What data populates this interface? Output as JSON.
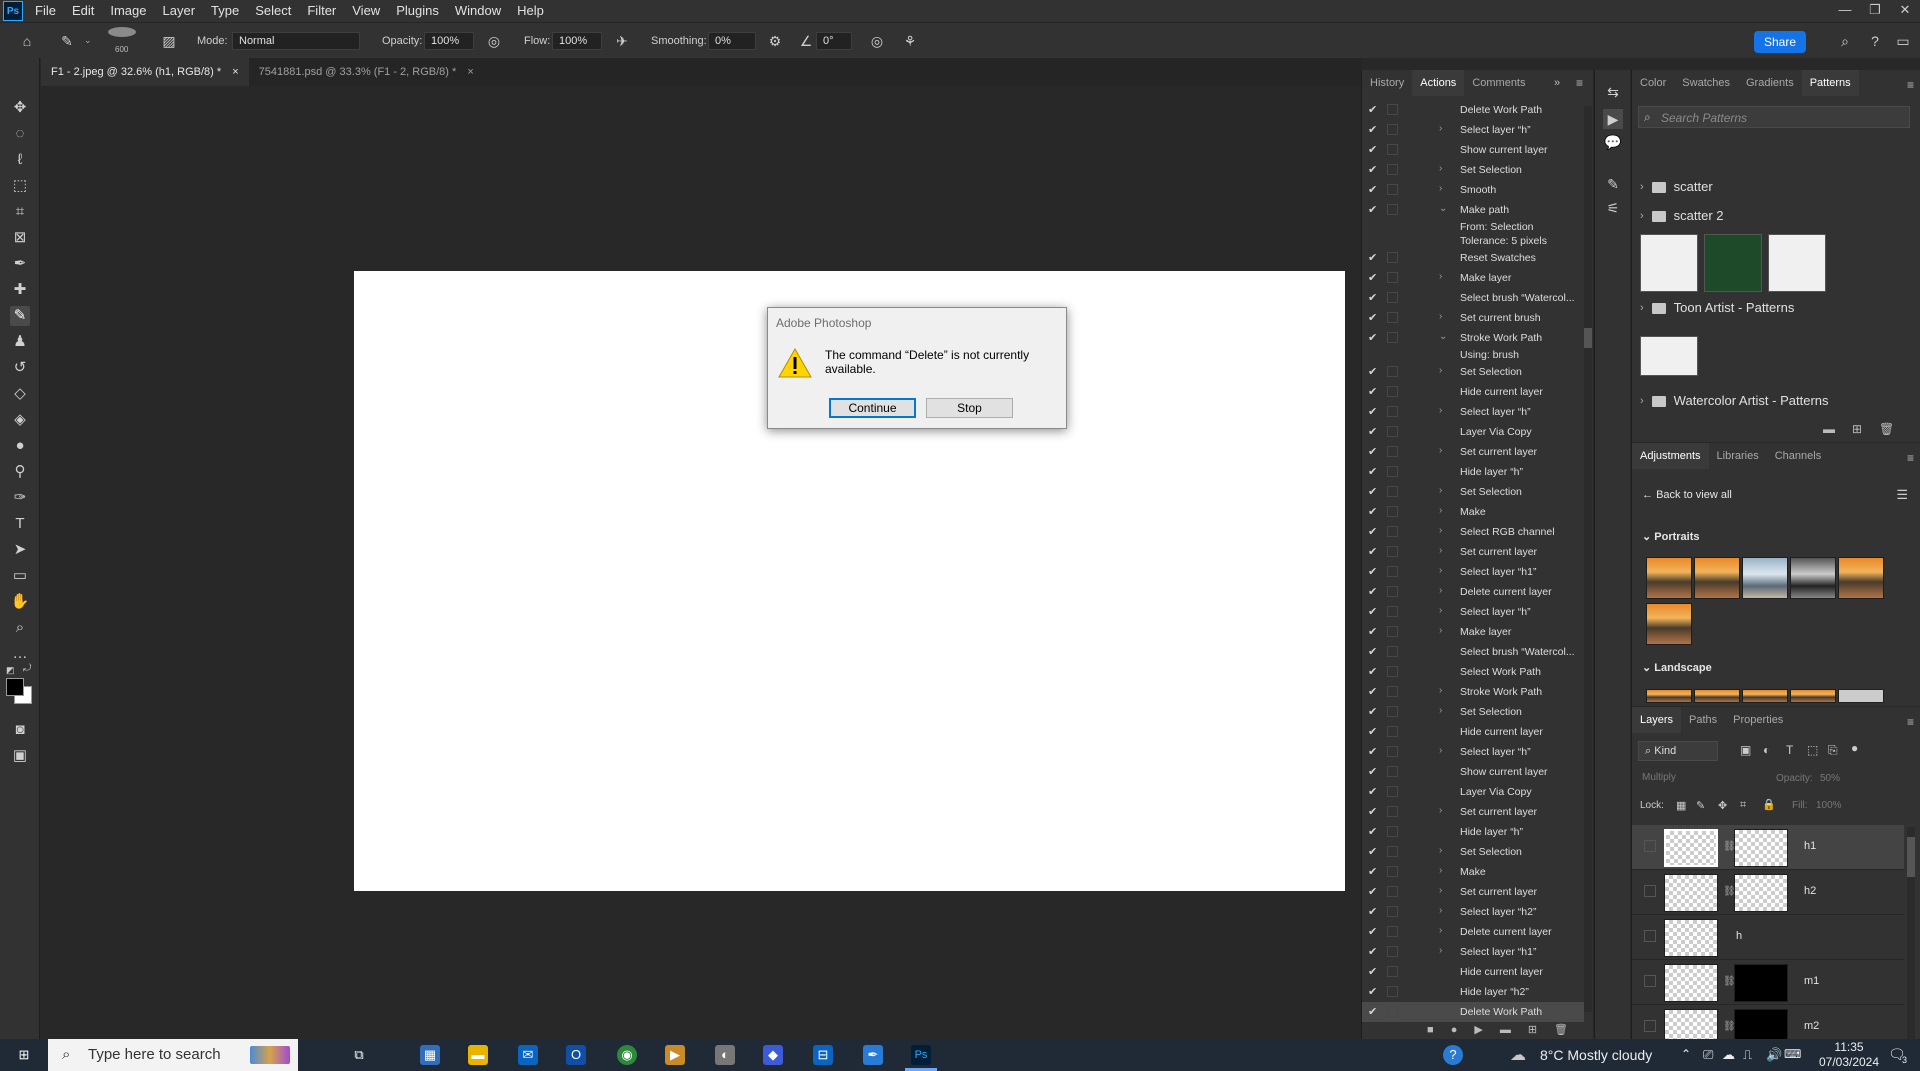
{
  "app": {
    "logo": "Ps"
  },
  "menu": [
    "File",
    "Edit",
    "Image",
    "Layer",
    "Type",
    "Select",
    "Filter",
    "View",
    "Plugins",
    "Window",
    "Help"
  ],
  "options": {
    "brush_size": "600",
    "mode_label": "Mode:",
    "mode_value": "Normal",
    "opacity_label": "Opacity:",
    "opacity_value": "100%",
    "flow_label": "Flow:",
    "flow_value": "100%",
    "smoothing_label": "Smoothing:",
    "smoothing_value": "0%",
    "angle_value": "0°",
    "share_label": "Share"
  },
  "doc_tabs": [
    {
      "label": "F1 - 2.jpeg @ 32.6% (h1, RGB/8) *",
      "close": "×"
    },
    {
      "label": "7541881.psd @ 33.3% (F1 - 2, RGB/8) *",
      "close": "×"
    }
  ],
  "dialog": {
    "title": "Adobe Photoshop",
    "message": "The command “Delete” is not currently available.",
    "continue_label": "Continue",
    "stop_label": "Stop"
  },
  "actions_panel": {
    "tabs": [
      "History",
      "Actions",
      "Comments"
    ],
    "items": [
      {
        "label": "Delete Work Path",
        "check": "✔",
        "expand": ""
      },
      {
        "label": "Select layer “h”",
        "check": "✔",
        "expand": "›"
      },
      {
        "label": "Show current layer",
        "check": "✔",
        "expand": ""
      },
      {
        "label": "Set Selection",
        "check": "✔",
        "expand": "›"
      },
      {
        "label": "Smooth",
        "check": "✔",
        "expand": "›"
      },
      {
        "label": "Make path",
        "check": "✔",
        "expand": "⌄"
      },
      {
        "label": "From: Selection",
        "check": "",
        "expand": "",
        "sub": true
      },
      {
        "label": "Tolerance: 5 pixels",
        "check": "",
        "expand": "",
        "sub": true
      },
      {
        "label": "Reset Swatches",
        "check": "✔",
        "expand": ""
      },
      {
        "label": "Make layer",
        "check": "✔",
        "expand": "›"
      },
      {
        "label": "Select brush “Watercol...",
        "check": "✔",
        "expand": ""
      },
      {
        "label": "Set current brush",
        "check": "✔",
        "expand": "›"
      },
      {
        "label": "Stroke Work Path",
        "check": "✔",
        "expand": "⌄"
      },
      {
        "label": "Using: brush",
        "check": "",
        "expand": "",
        "sub": true
      },
      {
        "label": "Set Selection",
        "check": "✔",
        "expand": "›"
      },
      {
        "label": "Hide current layer",
        "check": "✔",
        "expand": ""
      },
      {
        "label": "Select layer “h”",
        "check": "✔",
        "expand": "›"
      },
      {
        "label": "Layer Via Copy",
        "check": "✔",
        "expand": ""
      },
      {
        "label": "Set current layer",
        "check": "✔",
        "expand": "›"
      },
      {
        "label": "Hide layer “h”",
        "check": "✔",
        "expand": ""
      },
      {
        "label": "Set Selection",
        "check": "✔",
        "expand": "›"
      },
      {
        "label": "Make",
        "check": "✔",
        "expand": "›"
      },
      {
        "label": "Select RGB channel",
        "check": "✔",
        "expand": "›"
      },
      {
        "label": "Set current layer",
        "check": "✔",
        "expand": "›"
      },
      {
        "label": "Select layer “h1”",
        "check": "✔",
        "expand": "›"
      },
      {
        "label": "Delete current layer",
        "check": "✔",
        "expand": "›"
      },
      {
        "label": "Select layer “h”",
        "check": "✔",
        "expand": "›"
      },
      {
        "label": "Make layer",
        "check": "✔",
        "expand": "›"
      },
      {
        "label": "Select brush “Watercol...",
        "check": "✔",
        "expand": ""
      },
      {
        "label": "Select Work Path",
        "check": "✔",
        "expand": ""
      },
      {
        "label": "Stroke Work Path",
        "check": "✔",
        "expand": "›"
      },
      {
        "label": "Set Selection",
        "check": "✔",
        "expand": "›"
      },
      {
        "label": "Hide current layer",
        "check": "✔",
        "expand": ""
      },
      {
        "label": "Select layer “h”",
        "check": "✔",
        "expand": "›"
      },
      {
        "label": "Show current layer",
        "check": "✔",
        "expand": ""
      },
      {
        "label": "Layer Via Copy",
        "check": "✔",
        "expand": ""
      },
      {
        "label": "Set current layer",
        "check": "✔",
        "expand": "›"
      },
      {
        "label": "Hide layer “h”",
        "check": "✔",
        "expand": ""
      },
      {
        "label": "Set Selection",
        "check": "✔",
        "expand": "›"
      },
      {
        "label": "Make",
        "check": "✔",
        "expand": "›"
      },
      {
        "label": "Set current layer",
        "check": "✔",
        "expand": "›"
      },
      {
        "label": "Select layer “h2”",
        "check": "✔",
        "expand": "›"
      },
      {
        "label": "Delete current layer",
        "check": "✔",
        "expand": "›"
      },
      {
        "label": "Select layer “h1”",
        "check": "✔",
        "expand": "›"
      },
      {
        "label": "Hide current layer",
        "check": "✔",
        "expand": ""
      },
      {
        "label": "Hide layer “h2”",
        "check": "✔",
        "expand": ""
      },
      {
        "label": "Delete Work Path",
        "check": "✔",
        "expand": "",
        "selected": true
      }
    ]
  },
  "patterns_panel": {
    "tabs": [
      "Color",
      "Swatches",
      "Gradients",
      "Patterns"
    ],
    "search_placeholder": "Search Patterns",
    "groups": [
      "scatter",
      "scatter 2",
      "Toon Artist - Patterns",
      "Watercolor Artist - Patterns"
    ]
  },
  "adjustments_panel": {
    "tabs": [
      "Adjustments",
      "Libraries",
      "Channels"
    ],
    "back_label": "Back to view all",
    "section_portraits": "Portraits",
    "section_landscape": "Landscape"
  },
  "layers_panel": {
    "tabs": [
      "Layers",
      "Paths",
      "Properties"
    ],
    "kind_label": "Kind",
    "blend_mode": "Multiply",
    "opacity_label": "Opacity:",
    "opacity_value": "50%",
    "lock_label": "Lock:",
    "fill_label": "Fill:",
    "fill_value": "100%",
    "layers": [
      {
        "name": "h1",
        "mask": true,
        "selected": true
      },
      {
        "name": "h2",
        "mask": true
      },
      {
        "name": "h",
        "mask": false
      },
      {
        "name": "m1",
        "mask": true,
        "dark_mask": true
      },
      {
        "name": "m2",
        "mask": true,
        "dark_mask": true
      }
    ]
  },
  "taskbar": {
    "search_placeholder": "Type here to search",
    "weather": "8°C  Mostly cloudy",
    "time": "11:35",
    "date": "07/03/2024",
    "notif_count": "3"
  }
}
